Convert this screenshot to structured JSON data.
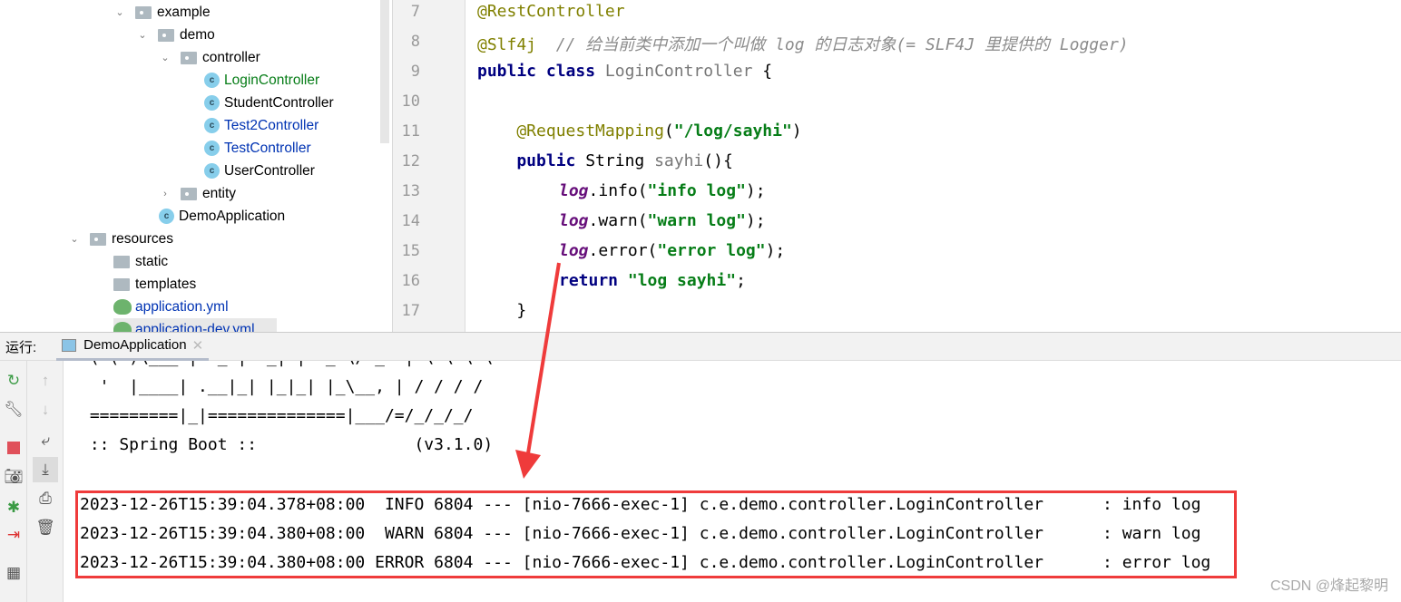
{
  "project_tree": [
    {
      "label": "example",
      "type": "package",
      "indent": 0,
      "expanded": true
    },
    {
      "label": "demo",
      "type": "package",
      "indent": 1,
      "expanded": true
    },
    {
      "label": "controller",
      "type": "package",
      "indent": 2,
      "expanded": true
    },
    {
      "label": "LoginController",
      "type": "class",
      "indent": 3,
      "color": "#067d17"
    },
    {
      "label": "StudentController",
      "type": "class",
      "indent": 3,
      "color": "#000000"
    },
    {
      "label": "Test2Controller",
      "type": "class",
      "indent": 3,
      "color": "#0033b3"
    },
    {
      "label": "TestController",
      "type": "class",
      "indent": 3,
      "color": "#0033b3"
    },
    {
      "label": "UserController",
      "type": "class",
      "indent": 3,
      "color": "#000000"
    },
    {
      "label": "entity",
      "type": "package",
      "indent": 2,
      "expanded": false
    },
    {
      "label": "DemoApplication",
      "type": "app",
      "indent": 2,
      "color": "#000000"
    },
    {
      "label": "resources",
      "type": "resources",
      "indent": -2,
      "expanded": true
    },
    {
      "label": "static",
      "type": "folder",
      "indent": -1
    },
    {
      "label": "templates",
      "type": "folder",
      "indent": -1
    },
    {
      "label": "application.yml",
      "type": "yml",
      "indent": -1,
      "color": "#0033b3"
    },
    {
      "label": "application-dev.yml",
      "type": "yml",
      "indent": -1,
      "color": "#0033b3"
    }
  ],
  "editor": {
    "line_numbers": [
      "7",
      "8",
      "9",
      "10",
      "11",
      "12",
      "13",
      "14",
      "15",
      "16",
      "17"
    ],
    "lines": {
      "l7": {
        "a": "@RestController"
      },
      "l8": {
        "a": "@Slf4j",
        "c": "  // 给当前类中添加一个叫做 log 的日志对象(= SLF4J 里提供的 Logger)"
      },
      "l9": {
        "k": "public class ",
        "n": "LoginController",
        " e": " {"
      },
      "l11": {
        "a": "    @RequestMapping",
        "p": "(",
        "s": "\"/log/sayhi\"",
        "e": ")"
      },
      "l12": {
        "k": "    public ",
        "t": "String ",
        "m": "sayhi",
        "e": "(){"
      },
      "l13": {
        "f": "log",
        "m": ".info(",
        "s": "\"info log\"",
        "e": ");"
      },
      "l14": {
        "f": "log",
        "m": ".warn(",
        "s": "\"warn log\"",
        "e": ");"
      },
      "l15": {
        "f": "log",
        "m": ".error(",
        "s": "\"error log\"",
        "e": ");"
      },
      "l16": {
        "k": "return ",
        "s": "\"log sayhi\"",
        "e": ";"
      },
      "l17": {
        "e": "    }"
      }
    }
  },
  "run_panel": {
    "label": "运行:",
    "tab": "DemoApplication"
  },
  "console": {
    "banner": [
      " ( ( )\\___ | '_ | '_| | '_ \\/ _` | \\ \\ \\ \\",
      "  '  |____| .__|_| |_|_| |_\\__, | / / / /",
      " =========|_|==============|___/=/_/_/_/",
      " :: Spring Boot ::                (v3.1.0)"
    ],
    "logs": [
      "2023-12-26T15:39:04.378+08:00  INFO 6804 --- [nio-7666-exec-1] c.e.demo.controller.LoginController      : info log",
      "2023-12-26T15:39:04.380+08:00  WARN 6804 --- [nio-7666-exec-1] c.e.demo.controller.LoginController      : warn log",
      "2023-12-26T15:39:04.380+08:00 ERROR 6804 --- [nio-7666-exec-1] c.e.demo.controller.LoginController      : error log"
    ]
  },
  "annotation_color": "#ef3b3b",
  "watermark": "CSDN @烽起黎明"
}
